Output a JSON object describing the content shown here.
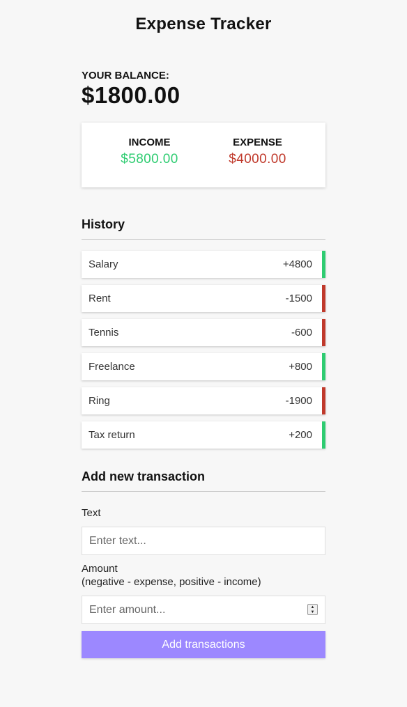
{
  "app": {
    "title": "Expense Tracker"
  },
  "balance": {
    "label": "Your Balance:",
    "value": "$1800.00"
  },
  "summary": {
    "income_label": "Income",
    "income_value": "$5800.00",
    "expense_label": "Expense",
    "expense_value": "$4000.00"
  },
  "history": {
    "title": "History",
    "items": [
      {
        "text": "Salary",
        "amount": "+4800",
        "type": "plus"
      },
      {
        "text": "Rent",
        "amount": "-1500",
        "type": "minus"
      },
      {
        "text": "Tennis",
        "amount": "-600",
        "type": "minus"
      },
      {
        "text": "Freelance",
        "amount": "+800",
        "type": "plus"
      },
      {
        "text": "Ring",
        "amount": "-1900",
        "type": "minus"
      },
      {
        "text": "Tax return",
        "amount": "+200",
        "type": "plus"
      }
    ]
  },
  "form": {
    "title": "Add new transaction",
    "text_label": "Text",
    "text_placeholder": "Enter text...",
    "amount_label": "Amount",
    "amount_hint": "(negative - expense, positive - income)",
    "amount_placeholder": "Enter amount...",
    "submit_label": "Add transactions"
  },
  "colors": {
    "income": "#2ecc71",
    "expense": "#c0392b",
    "button": "#9c88ff"
  }
}
